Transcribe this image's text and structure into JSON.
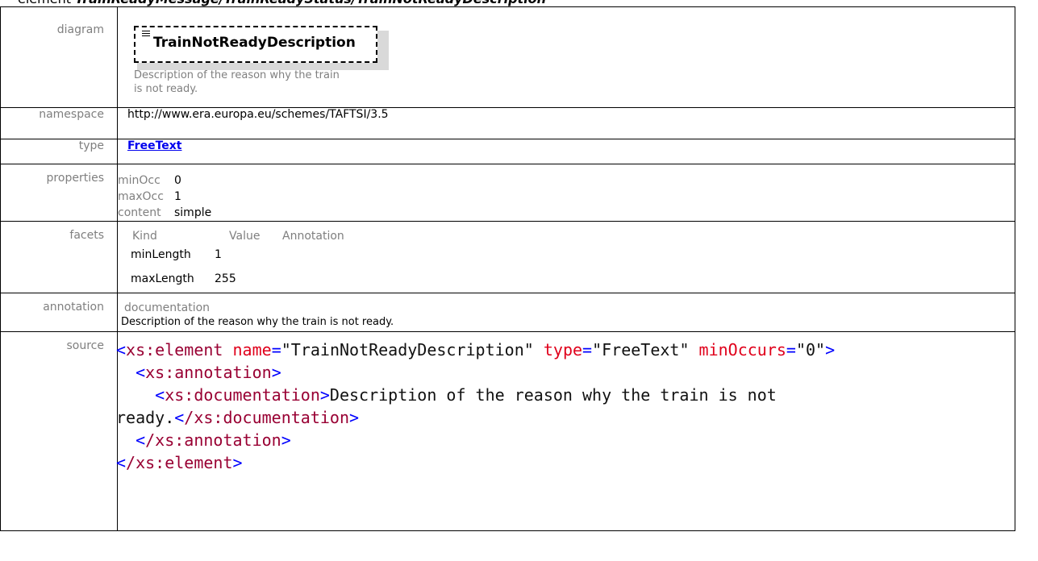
{
  "page_title": {
    "prefix": "element ",
    "path": "TrainReadyMessage/TrainReadyStatus/TrainNotReadyDescription"
  },
  "rows": {
    "diagram": {
      "label": "diagram",
      "element_name": "TrainNotReadyDescription",
      "description": "Description of the reason why the train is not ready."
    },
    "namespace": {
      "label": "namespace",
      "value": "http://www.era.europa.eu/schemes/TAFTSI/3.5"
    },
    "type": {
      "label": "type",
      "value": "FreeText"
    },
    "properties": {
      "label": "properties",
      "items": [
        {
          "key": "minOcc",
          "value": "0"
        },
        {
          "key": "maxOcc",
          "value": "1"
        },
        {
          "key": "content",
          "value": "simple"
        }
      ]
    },
    "facets": {
      "label": "facets",
      "headers": [
        "Kind",
        "Value",
        "Annotation"
      ],
      "rows": [
        {
          "kind": "minLength",
          "value": "1",
          "annotation": ""
        },
        {
          "kind": "maxLength",
          "value": "255",
          "annotation": ""
        }
      ]
    },
    "annotation": {
      "label": "annotation",
      "key": "documentation",
      "text": "Description of the reason why the train is not ready."
    },
    "source": {
      "label": "source",
      "element_tag": "xs:element",
      "name_attr": "name",
      "name_value": "\"TrainNotReadyDescription\"",
      "type_attr": "type",
      "type_value": "\"FreeText\"",
      "minocc_attr": "minOccurs",
      "minocc_value": "\"0\"",
      "annotation_tag": "xs:annotation",
      "documentation_tag": "xs:documentation",
      "doc_text_line1": "Description of the reason why the train is not",
      "doc_text_line2": "ready.",
      "closing_documentation": "/xs:documentation",
      "closing_annotation": "/xs:annotation",
      "closing_element": "/xs:element"
    }
  }
}
